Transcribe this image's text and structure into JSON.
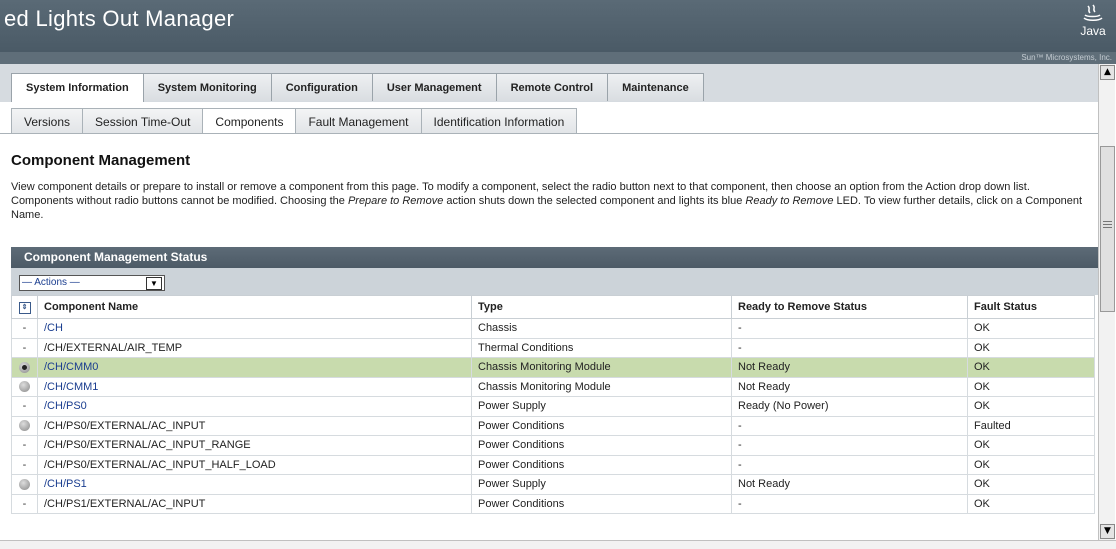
{
  "app": {
    "title": "ed Lights Out Manager",
    "logo_text": "Java",
    "company": "Sun™ Microsystems, Inc."
  },
  "tabs": [
    {
      "label": "System Information",
      "active": true
    },
    {
      "label": "System Monitoring",
      "active": false
    },
    {
      "label": "Configuration",
      "active": false
    },
    {
      "label": "User Management",
      "active": false
    },
    {
      "label": "Remote Control",
      "active": false
    },
    {
      "label": "Maintenance",
      "active": false
    }
  ],
  "subtabs": [
    {
      "label": "Versions",
      "active": false
    },
    {
      "label": "Session Time-Out",
      "active": false
    },
    {
      "label": "Components",
      "active": true
    },
    {
      "label": "Fault Management",
      "active": false
    },
    {
      "label": "Identification Information",
      "active": false
    }
  ],
  "page": {
    "title": "Component Management",
    "intro": {
      "p1": "View component details or prepare to install or remove a component from this page. To modify a component, select the radio button next to that component, then choose an option from the Action drop down list. Components without radio buttons cannot be modified. Choosing the ",
      "em1": "Prepare to Remove",
      "p2": " action shuts down the selected component and lights its blue ",
      "em2": "Ready to Remove",
      "p3": " LED. To view further details, click on a Component Name."
    }
  },
  "panel": {
    "title": "Component Management Status",
    "actions_label": "— Actions —",
    "columns": [
      "Component Name",
      "Type",
      "Ready to Remove Status",
      "Fault Status"
    ],
    "rows": [
      {
        "sel": "-",
        "name": "/CH",
        "link": true,
        "type": "Chassis",
        "ready": "-",
        "fault": "OK"
      },
      {
        "sel": "-",
        "name": "/CH/EXTERNAL/AIR_TEMP",
        "link": false,
        "type": "Thermal Conditions",
        "ready": "-",
        "fault": "OK"
      },
      {
        "sel": "radio-checked",
        "name": "/CH/CMM0",
        "link": true,
        "type": "Chassis Monitoring Module",
        "ready": "Not Ready",
        "fault": "OK",
        "selected": true
      },
      {
        "sel": "radio",
        "name": "/CH/CMM1",
        "link": true,
        "type": "Chassis Monitoring Module",
        "ready": "Not Ready",
        "fault": "OK"
      },
      {
        "sel": "-",
        "name": "/CH/PS0",
        "link": true,
        "type": "Power Supply",
        "ready": "Ready (No Power)",
        "fault": "OK"
      },
      {
        "sel": "radio",
        "name": "/CH/PS0/EXTERNAL/AC_INPUT",
        "link": false,
        "type": "Power Conditions",
        "ready": "-",
        "fault": "Faulted"
      },
      {
        "sel": "-",
        "name": "/CH/PS0/EXTERNAL/AC_INPUT_RANGE",
        "link": false,
        "type": "Power Conditions",
        "ready": "-",
        "fault": "OK"
      },
      {
        "sel": "-",
        "name": "/CH/PS0/EXTERNAL/AC_INPUT_HALF_LOAD",
        "link": false,
        "type": "Power Conditions",
        "ready": "-",
        "fault": "OK"
      },
      {
        "sel": "radio",
        "name": "/CH/PS1",
        "link": true,
        "type": "Power Supply",
        "ready": "Not Ready",
        "fault": "OK"
      },
      {
        "sel": "-",
        "name": "/CH/PS1/EXTERNAL/AC_INPUT",
        "link": false,
        "type": "Power Conditions",
        "ready": "-",
        "fault": "OK"
      }
    ]
  },
  "colors": {
    "header": "#4f5f6b",
    "selected_row": "#c8dbad",
    "link": "#1a3d8f"
  }
}
